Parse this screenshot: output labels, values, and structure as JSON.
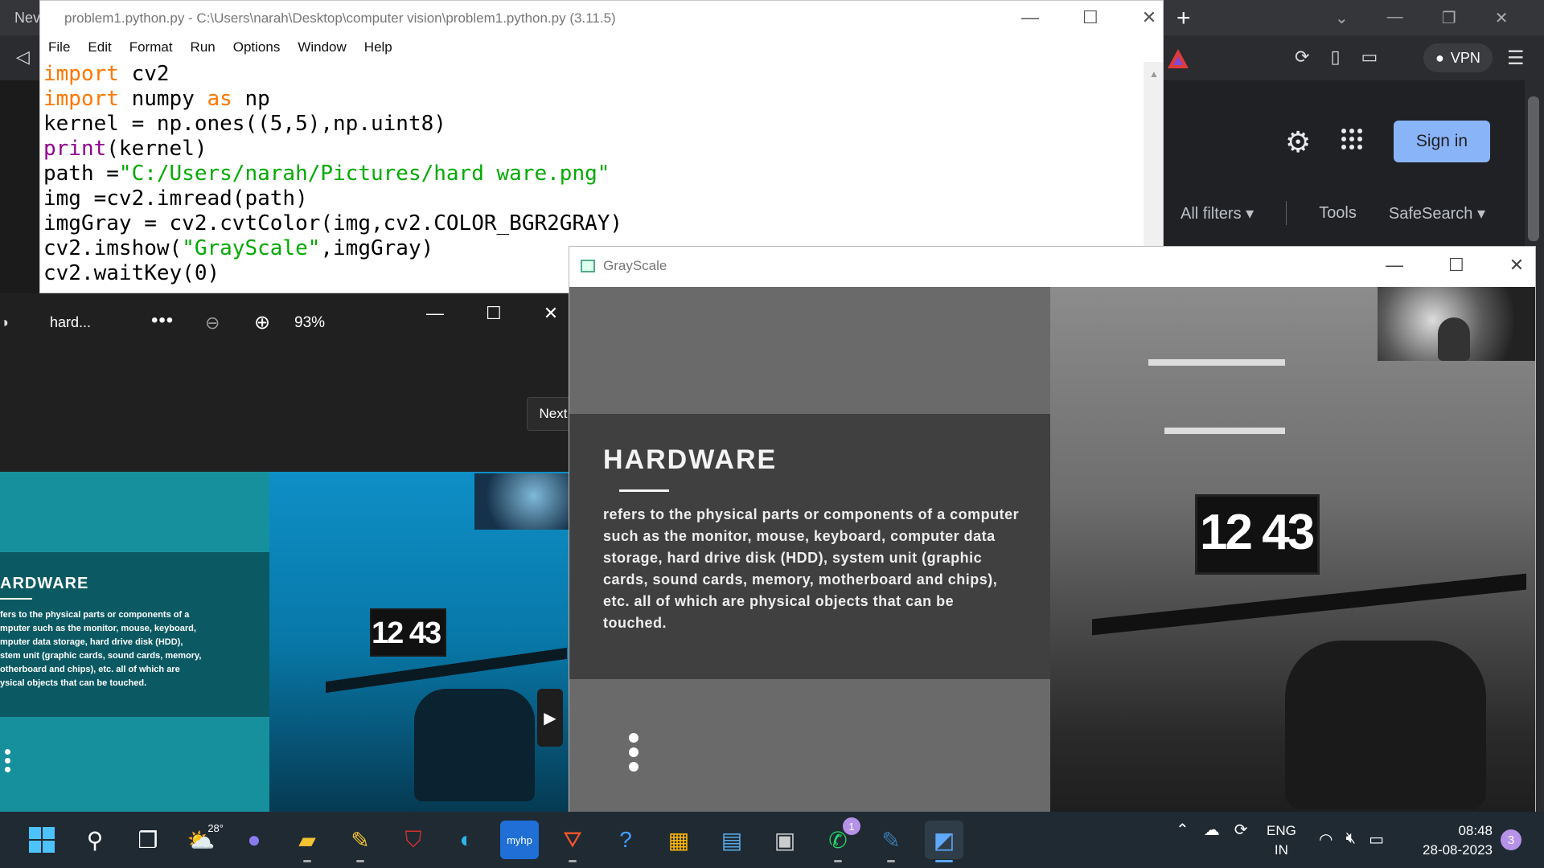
{
  "browser": {
    "tab_label": "Nev",
    "vpn_label": "VPN",
    "google": {
      "sign_in": "Sign in",
      "filters": [
        "All filters",
        "Tools",
        "SafeSearch"
      ]
    }
  },
  "idle": {
    "title": "problem1.python.py - C:\\Users\\narah\\Desktop\\computer vision\\problem1.python.py (3.11.5)",
    "menu": [
      "File",
      "Edit",
      "Format",
      "Run",
      "Options",
      "Window",
      "Help"
    ]
  },
  "photos": {
    "title": "hard...",
    "zoom": "93%",
    "next_tooltip": "Next",
    "slide_heading": "ARDWARE",
    "slide_body": "fers to the physical parts or components of a\nmputer such as the monitor, mouse, keyboard,\nmputer data storage, hard drive disk (HDD),\nstem unit (graphic cards, sound cards, memory,\notherboard and chips), etc. all of which are\nysical objects that can be touched.",
    "clock": "12 43"
  },
  "grayscale": {
    "title": "GrayScale",
    "slide_heading": "HARDWARE",
    "slide_body": "refers to the physical parts or components of a computer such as the monitor, mouse, keyboard, computer data storage, hard drive disk (HDD), system unit (graphic cards, sound cards, memory, motherboard and chips), etc. all of which are physical objects that can be touched.",
    "clock": "12 43"
  },
  "taskbar": {
    "weather_temp": "28°",
    "whatsapp_badge": "1",
    "lang_line1": "ENG",
    "lang_line2": "IN",
    "time": "08:48",
    "date": "28-08-2023",
    "notifications": "3"
  },
  "colors": {
    "idle_keyword": "#ff7700",
    "idle_string": "#00aa00",
    "idle_builtin": "#900090",
    "google_signin": "#8ab4f8"
  }
}
